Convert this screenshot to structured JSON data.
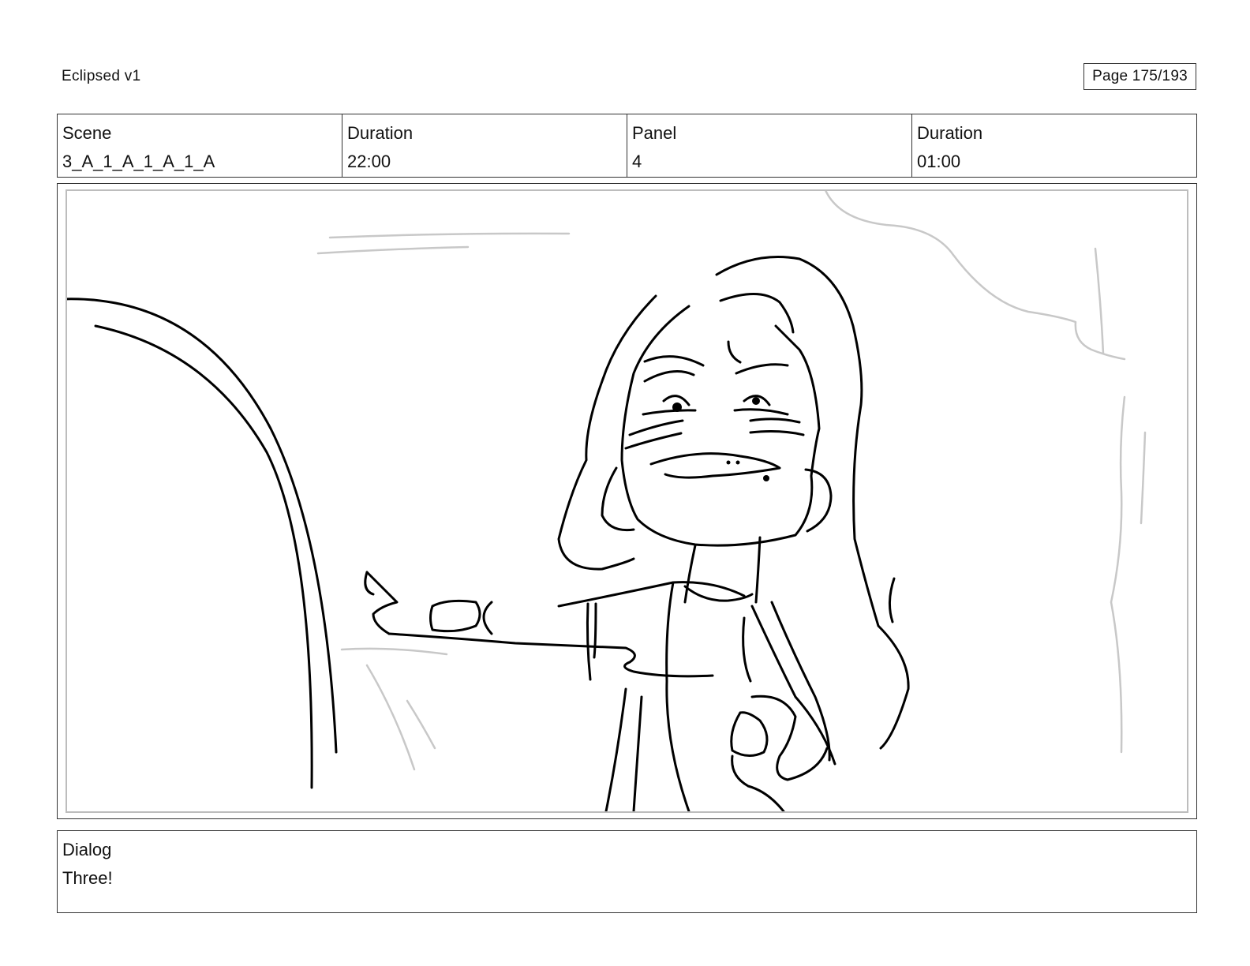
{
  "header": {
    "doc_title": "Eclipsed v1",
    "page_indicator": "Page 175/193"
  },
  "info": {
    "scene_label": "Scene",
    "scene_value": "3_A_1_A_1_A_1_A",
    "scene_duration_label": "Duration",
    "scene_duration_value": "22:00",
    "panel_label": "Panel",
    "panel_value": "4",
    "panel_duration_label": "Duration",
    "panel_duration_value": "01:00"
  },
  "dialog": {
    "label": "Dialog",
    "text": "Three!"
  }
}
